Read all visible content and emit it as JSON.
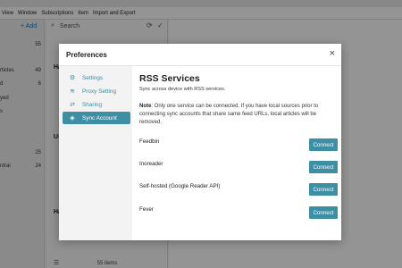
{
  "menubar": [
    "View",
    "Window",
    "Subscriptions",
    "Item",
    "Import and Export"
  ],
  "sidebar": {
    "add_label": "+ Add",
    "rows": [
      {
        "label": "",
        "count": "55"
      },
      {
        "label": "rticles",
        "count": "49"
      },
      {
        "label": "d",
        "count": "6"
      },
      {
        "label": "yed",
        "count": ""
      },
      {
        "label": "s",
        "count": ""
      },
      {
        "label": "",
        "count": "25"
      },
      {
        "label": "ntral",
        "count": "24"
      }
    ]
  },
  "list": {
    "search_placeholder": "Search",
    "items": [
      "Ha",
      "Us",
      "Ha"
    ],
    "footer": "55 items"
  },
  "dialog": {
    "title": "Preferences",
    "close": "×",
    "nav": [
      {
        "label": "Settings",
        "icon": "gear-icon",
        "glyph": "⚙",
        "active": false
      },
      {
        "label": "Proxy Setting",
        "icon": "wifi-icon",
        "glyph": "≋",
        "active": false
      },
      {
        "label": "Sharing",
        "icon": "share-icon",
        "glyph": "⇄",
        "active": false
      },
      {
        "label": "Sync Account",
        "icon": "cube-icon",
        "glyph": "◈",
        "active": true
      }
    ],
    "pane": {
      "title": "RSS Services",
      "subtitle": "Sync across device with RSS services.",
      "note_label": "Note",
      "note_text": ": Only one service can be connected. If you have local sources prior to connecting sync accounts that share same feed URLs, local articles will be removed.",
      "services": [
        {
          "name": "Feedbin",
          "button": "Connect"
        },
        {
          "name": "Inoreader",
          "button": "Connect"
        },
        {
          "name": "Self-hosted (Google Reader API)",
          "button": "Connect"
        },
        {
          "name": "Fever",
          "button": "Connect"
        }
      ]
    }
  },
  "colors": {
    "accent": "#3f8fa4",
    "overlay": "rgba(0,0,0,0.42)"
  }
}
